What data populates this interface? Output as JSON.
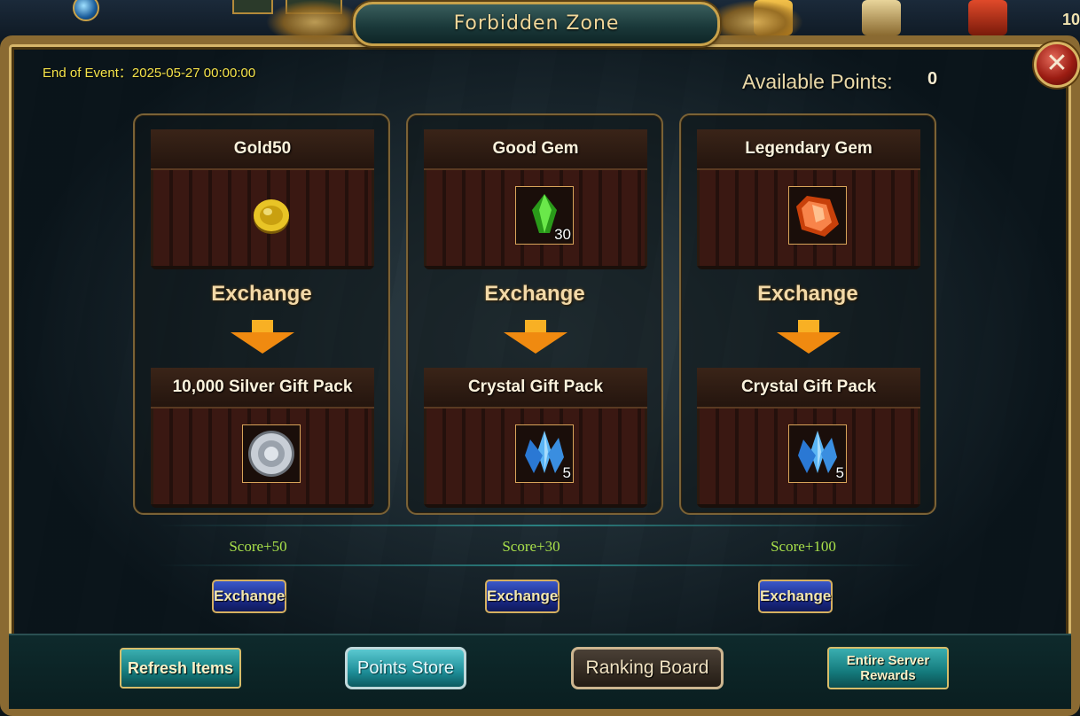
{
  "hud": {
    "corner_number": "10"
  },
  "window": {
    "title": "Forbidden Zone",
    "close_symbol": "✕"
  },
  "event": {
    "end_text": "End of Event：2025-05-27 00:00:00"
  },
  "points": {
    "label": "Available Points:",
    "value": "0"
  },
  "exchange_label": "Exchange",
  "cards": [
    {
      "cost_name": "Gold50",
      "cost_icon": "gold-coin-icon",
      "cost_count": "",
      "reward_name": "10,000 Silver Gift Pack",
      "reward_icon": "silver-coin-icon",
      "reward_count": "",
      "score": "Score+50",
      "button": "Exchange"
    },
    {
      "cost_name": "Good Gem",
      "cost_icon": "green-gem-icon",
      "cost_count": "30",
      "reward_name": "Crystal Gift Pack",
      "reward_icon": "blue-crystal-icon",
      "reward_count": "5",
      "score": "Score+30",
      "button": "Exchange"
    },
    {
      "cost_name": "Legendary Gem",
      "cost_icon": "orange-gem-icon",
      "cost_count": "",
      "reward_name": "Crystal Gift Pack",
      "reward_icon": "blue-crystal-icon",
      "reward_count": "5",
      "score": "Score+100",
      "button": "Exchange"
    }
  ],
  "bottom": {
    "refresh": "Refresh Items",
    "points_store": "Points Store",
    "ranking": "Ranking Board",
    "server_rewards_line1": "Entire Server",
    "server_rewards_line2": "Rewards"
  },
  "colors": {
    "event_text": "#f6e44a",
    "score_text": "#a9e04a",
    "gold_trim": "#c9a24a",
    "exchange_button": "#1a2a8a",
    "teal_button": "#147a7c"
  }
}
